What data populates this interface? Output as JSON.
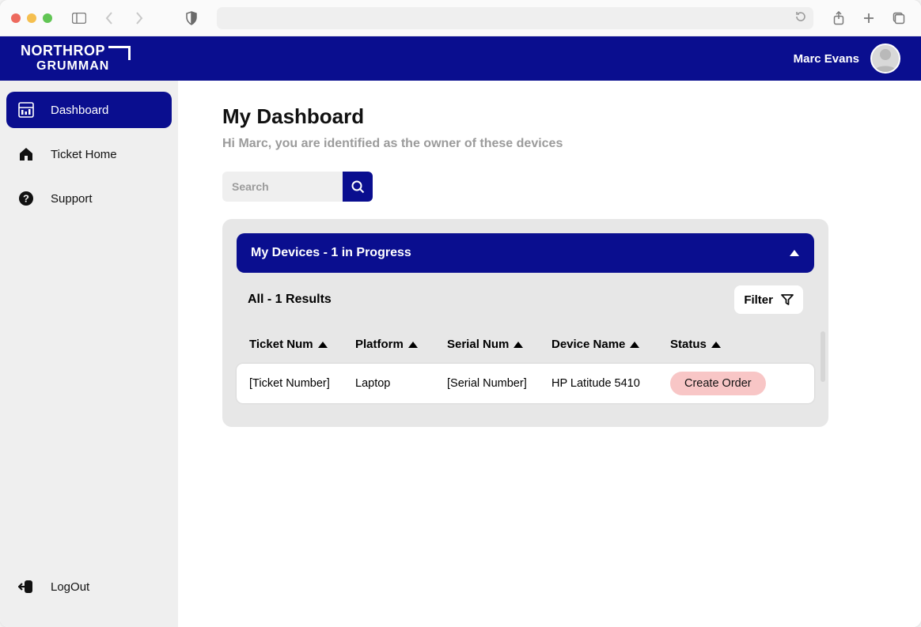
{
  "colors": {
    "brand": "#0a0e8f",
    "status_pill": "#f8c6c6"
  },
  "header": {
    "user_name": "Marc Evans"
  },
  "logo": {
    "line1": "NORTHROP",
    "line2": "GRUMMAN"
  },
  "sidebar": {
    "items": [
      {
        "label": "Dashboard",
        "icon": "dashboard-icon"
      },
      {
        "label": "Ticket Home",
        "icon": "home-icon"
      },
      {
        "label": "Support",
        "icon": "help-icon"
      }
    ],
    "logout_label": "LogOut"
  },
  "page": {
    "title": "My Dashboard",
    "subtitle": "Hi Marc, you are identified as the owner of these devices"
  },
  "search": {
    "placeholder": "Search"
  },
  "panel": {
    "header": "My Devices - 1 in Progress",
    "sub": "All - 1 Results",
    "filter_label": "Filter",
    "columns": {
      "ticket": "Ticket Num",
      "platform": "Platform",
      "serial": "Serial Num",
      "device": "Device Name",
      "status": "Status"
    },
    "rows": [
      {
        "ticket": "[Ticket Number]",
        "platform": "Laptop",
        "serial": "[Serial Number]",
        "device": "HP Latitude 5410",
        "status": "Create Order"
      }
    ]
  }
}
